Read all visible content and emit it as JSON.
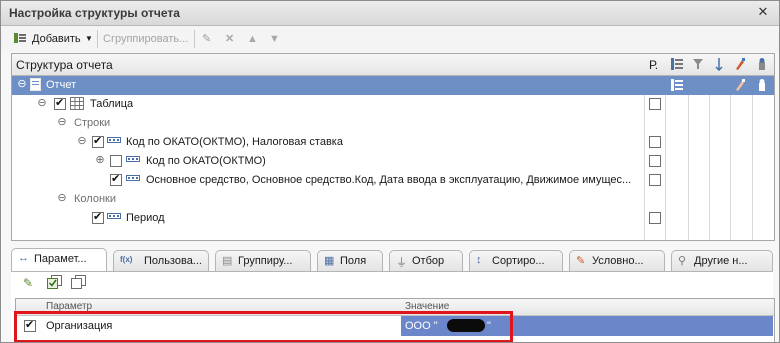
{
  "window": {
    "title": "Настройка структуры отчета",
    "close_glyph": "✕"
  },
  "toolbar": {
    "add_label": "Добавить",
    "group_label": "Сгруппировать..."
  },
  "tree": {
    "header": "Структура отчета",
    "col_p": "Р.",
    "rows": [
      {
        "label": "Отчет"
      },
      {
        "label": "Таблица"
      },
      {
        "label": "Строки"
      },
      {
        "label": "Код по ОКАТО(ОКТМО), Налоговая ставка"
      },
      {
        "label": "Код по ОКАТО(ОКТМО)"
      },
      {
        "label": "Основное средство, Основное средство.Код, Дата ввода в эксплуатацию, Движимое имущес..."
      },
      {
        "label": "Колонки"
      },
      {
        "label": "Период"
      }
    ]
  },
  "tabs": [
    {
      "label": "Парамет...",
      "icon": "↔"
    },
    {
      "label": "Пользова...",
      "icon": "f(x)"
    },
    {
      "label": "Группиру...",
      "icon": "▤"
    },
    {
      "label": "Поля",
      "icon": "▦"
    },
    {
      "label": "Отбор",
      "icon": "⏚"
    },
    {
      "label": "Сортиро...",
      "icon": "↕"
    },
    {
      "label": "Условно...",
      "icon": "✎"
    },
    {
      "label": "Другие н...",
      "icon": "⚲"
    }
  ],
  "params": {
    "col_param": "Параметр",
    "col_value": "Значение",
    "row": {
      "name": "Организация",
      "value": "ООО \"",
      "value_tail": "\""
    }
  },
  "colors": {
    "selection": "#6d8fc6",
    "highlight_border": "#e0141b"
  }
}
